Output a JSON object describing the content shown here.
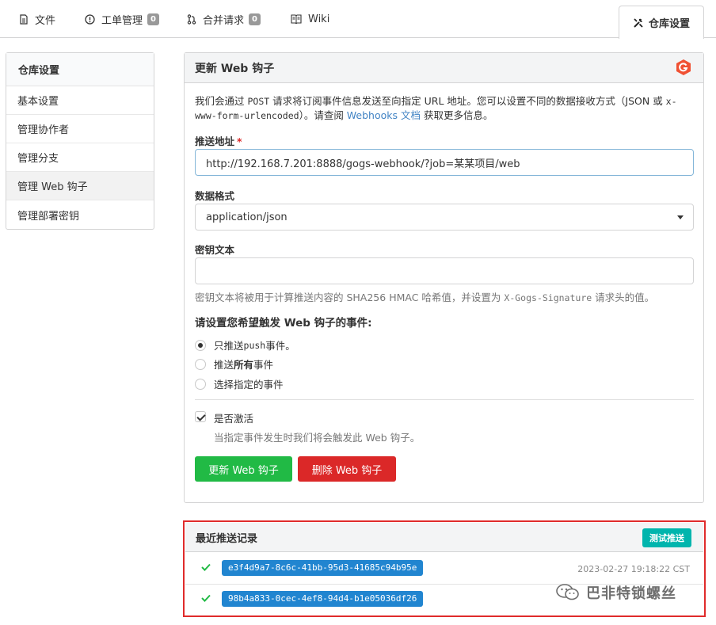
{
  "tabs": {
    "files": "文件",
    "issues": "工单管理",
    "issues_count": "0",
    "pulls": "合并请求",
    "pulls_count": "0",
    "wiki": "Wiki",
    "settings": "仓库设置"
  },
  "sidebar": {
    "title": "仓库设置",
    "items": [
      {
        "label": "基本设置"
      },
      {
        "label": "管理协作者"
      },
      {
        "label": "管理分支"
      },
      {
        "label": "管理 Web 钩子"
      },
      {
        "label": "管理部署密钥"
      }
    ]
  },
  "panel": {
    "title": "更新 Web 钩子",
    "intro_pre": "我们会通过 ",
    "intro_post_code": "POST",
    "intro_mid": " 请求将订阅事件信息发送至向指定 URL 地址。您可以设置不同的数据接收方式（JSON 或 ",
    "intro_form": "x-www-form-urlencoded",
    "intro_after": "）。请查阅 ",
    "intro_link": "Webhooks 文档",
    "intro_end": " 获取更多信息。",
    "url_label": "推送地址",
    "url_required": "*",
    "url_value": "http://192.168.7.201:8888/gogs-webhook/?job=某某项目/web",
    "format_label": "数据格式",
    "format_value": "application/json",
    "secret_label": "密钥文本",
    "secret_value": "",
    "secret_help_pre": "密钥文本将被用于计算推送内容的 SHA256 HMAC 哈希值，并设置为 ",
    "secret_help_code": "X-Gogs-Signature",
    "secret_help_post": " 请求头的值。",
    "events_label": "请设置您希望触发 Web 钩子的事件:",
    "event_push_pre": "只推送 ",
    "event_push_code": "push",
    "event_push_post": " 事件。",
    "event_all_pre": "推送 ",
    "event_all_bold": "所有",
    "event_all_post": " 事件",
    "event_choose": "选择指定的事件",
    "active_label": "是否激活",
    "active_help": "当指定事件发生时我们将会触发此 Web 钩子。",
    "update_button": "更新 Web 钩子",
    "delete_button": "删除 Web 钩子"
  },
  "deliveries": {
    "title": "最近推送记录",
    "test_button": "测试推送",
    "rows": [
      {
        "hash": "e3f4d9a7-8c6c-41bb-95d3-41685c94b95e",
        "time": "2023-02-27 19:18:22 CST"
      },
      {
        "hash": "98b4a833-0cec-4ef8-94d4-b1e05036df26",
        "time": ""
      }
    ]
  },
  "watermark": "巴非特锁螺丝",
  "colors": {
    "green": "#21ba45",
    "red": "#db2828",
    "teal": "#00b5ad",
    "blue": "#2185d0",
    "highlight_border": "#e02b2b",
    "link": "#4183c4"
  }
}
